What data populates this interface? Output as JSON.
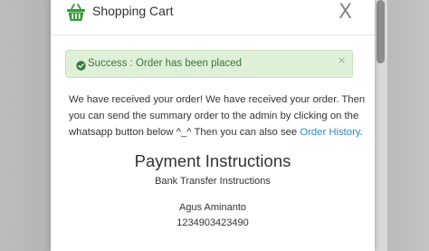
{
  "modal": {
    "title": "Shopping Cart",
    "close_label": "X"
  },
  "alert": {
    "text": "Success : Order has been placed",
    "close_label": "×"
  },
  "message": {
    "line1": "We have received your order! We have received your order. Then",
    "line2": "you can send the summary order to the admin by clicking on the",
    "line3_prefix": "whatsapp button below ^_^ Then you can also see ",
    "order_history_link": "Order History",
    "line3_suffix": "."
  },
  "payment": {
    "title": "Payment Instructions",
    "subtitle": "Bank Transfer Instructions",
    "account_name": "Agus Aminanto",
    "account_number": "1234903423490"
  },
  "colors": {
    "brand_green": "#3a9a3d",
    "alert_bg": "#dff0d8",
    "alert_text": "#3c763d",
    "link": "#2a8bc3"
  },
  "icons": {
    "cart": "shopping-basket-icon",
    "success": "check-circle-icon"
  }
}
